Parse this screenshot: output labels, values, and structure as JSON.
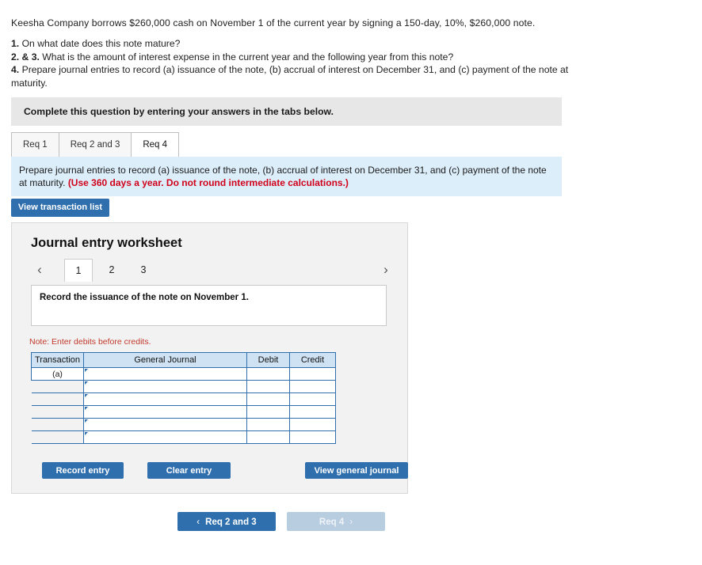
{
  "problem": {
    "stem": "Keesha Company borrows $260,000 cash on November 1 of the current year by signing a 150-day, 10%, $260,000 note.",
    "requirements": [
      {
        "num": "1.",
        "text": "On what date does this note mature?"
      },
      {
        "num": "2. & 3.",
        "text": "What is the amount of interest expense in the current year and the following year from this note?"
      },
      {
        "num": "4.",
        "text": "Prepare journal entries to record (a) issuance of the note, (b) accrual of interest on December 31, and (c) payment of the note at maturity."
      }
    ]
  },
  "banner": {
    "text": "Complete this question by entering your answers in the tabs below."
  },
  "tabs": [
    {
      "label": "Req 1",
      "active": false
    },
    {
      "label": "Req 2 and 3",
      "active": false
    },
    {
      "label": "Req 4",
      "active": true
    }
  ],
  "instruction": {
    "main": "Prepare journal entries to record (a) issuance of the note, (b) accrual of interest on December 31, and (c) payment of the note at maturity.",
    "highlight": "(Use 360 days a year. Do not round intermediate calculations.)"
  },
  "buttons": {
    "view_transaction_list": "View transaction list",
    "record_entry": "Record entry",
    "clear_entry": "Clear entry",
    "view_general_journal": "View general journal"
  },
  "worksheet": {
    "title": "Journal entry worksheet",
    "pages": [
      "1",
      "2",
      "3"
    ],
    "active_page": "1",
    "prev_icon": "chevron-left-icon",
    "next_icon": "chevron-right-icon",
    "prompt": "Record the issuance of the note on November 1.",
    "note": "Note: Enter debits before credits.",
    "table": {
      "headers": [
        "Transaction",
        "General Journal",
        "Debit",
        "Credit"
      ],
      "rows": [
        {
          "transaction": "(a)",
          "general_journal": "",
          "debit": "",
          "credit": ""
        },
        {
          "transaction": "",
          "general_journal": "",
          "debit": "",
          "credit": ""
        },
        {
          "transaction": "",
          "general_journal": "",
          "debit": "",
          "credit": ""
        },
        {
          "transaction": "",
          "general_journal": "",
          "debit": "",
          "credit": ""
        },
        {
          "transaction": "",
          "general_journal": "",
          "debit": "",
          "credit": ""
        },
        {
          "transaction": "",
          "general_journal": "",
          "debit": "",
          "credit": ""
        }
      ]
    }
  },
  "footer_nav": {
    "prev_label": "Req 2 and 3",
    "prev_icon": "chevron-left-icon",
    "next_label": "Req 4",
    "next_icon": "chevron-right-icon"
  },
  "colors": {
    "accent": "#2f6fad",
    "banner_gray": "#e7e7e7",
    "instruction_blue": "#ddeefb",
    "header_blue": "#cfe2f3",
    "red_note": "#c0392b"
  }
}
